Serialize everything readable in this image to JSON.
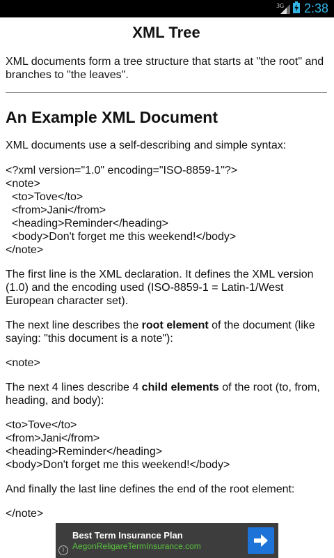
{
  "status_bar": {
    "network_label": "3G",
    "time": "2:38",
    "accent_color": "#33b5e5"
  },
  "article": {
    "title": "XML Tree",
    "intro": "XML documents form a tree structure that starts at \"the root\" and branches to \"the leaves\".",
    "section_heading": "An Example XML Document",
    "syntax_text": "XML documents use a self-describing and simple syntax:",
    "code_lines": [
      "<?xml version=\"1.0\" encoding=\"ISO-8859-1\"?>",
      "<note>",
      "  <to>Tove</to>",
      "  <from>Jani</from>",
      "  <heading>Reminder</heading>",
      "  <body>Don't forget me this weekend!</body>",
      "</note>"
    ],
    "declaration_text": "The first line is the XML declaration. It defines the XML version (1.0) and the encoding used (ISO-8859-1 = Latin-1/West European character set).",
    "root_text_before": "The next line describes the ",
    "root_text_bold": "root element",
    "root_text_after": " of the document (like saying: \"this document is a note\"):",
    "root_line": "<note>",
    "child_text_before": "The next 4 lines describe 4 ",
    "child_text_bold": "child elements",
    "child_text_after": " of the root (to, from, heading, and body):",
    "child_lines": [
      "<to>Tove</to>",
      "<from>Jani</from>",
      "<heading>Reminder</heading>",
      "<body>Don't forget me this weekend!</body>"
    ],
    "final_text": "And finally the last line defines the end of the root element:",
    "end_line": "</note>"
  },
  "ad": {
    "title": "Best Term Insurance Plan",
    "url": "AegonReligareTermInsurance.com",
    "info_label": "i",
    "button_color": "#1e73d8"
  }
}
